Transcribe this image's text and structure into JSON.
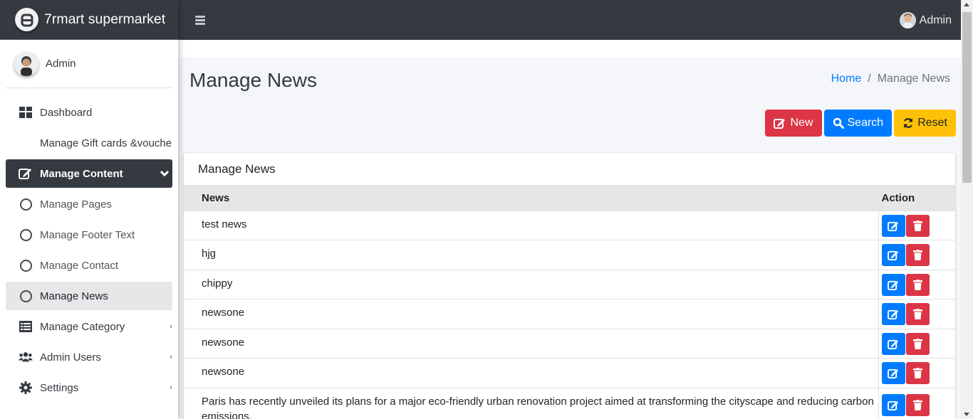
{
  "brand": {
    "name": "7rmart supermarket"
  },
  "user": {
    "name": "Admin"
  },
  "header": {
    "user_label": "Admin"
  },
  "sidebar": {
    "items": [
      {
        "label": "Dashboard",
        "icon": "dashboard-icon"
      },
      {
        "label": "Manage Gift cards &voucher"
      },
      {
        "label": "Manage Content",
        "icon": "edit-icon"
      },
      {
        "label": "Manage Pages",
        "icon": "circle-icon"
      },
      {
        "label": "Manage Footer Text",
        "icon": "circle-icon"
      },
      {
        "label": "Manage Contact",
        "icon": "circle-icon"
      },
      {
        "label": "Manage News",
        "icon": "circle-icon"
      },
      {
        "label": "Manage Category",
        "icon": "list-icon"
      },
      {
        "label": "Admin Users",
        "icon": "users-icon"
      },
      {
        "label": "Settings",
        "icon": "gear-icon"
      }
    ]
  },
  "page": {
    "title": "Manage News",
    "breadcrumb": {
      "home": "Home",
      "separator": "/",
      "current": "Manage News"
    }
  },
  "actions": {
    "new_label": "New",
    "search_label": "Search",
    "reset_label": "Reset"
  },
  "card": {
    "title": "Manage News",
    "columns": [
      "News",
      "Action"
    ],
    "rows": [
      "test news",
      "hjg",
      "chippy",
      "newsone",
      "newsone",
      "newsone",
      "Paris has recently unveiled its plans for a major eco-friendly urban renovation project aimed at transforming the cityscape and reducing carbon emissions."
    ]
  },
  "colors": {
    "primary": "#007bff",
    "danger": "#dc3545",
    "warning": "#ffc107",
    "dark": "#343a40"
  }
}
